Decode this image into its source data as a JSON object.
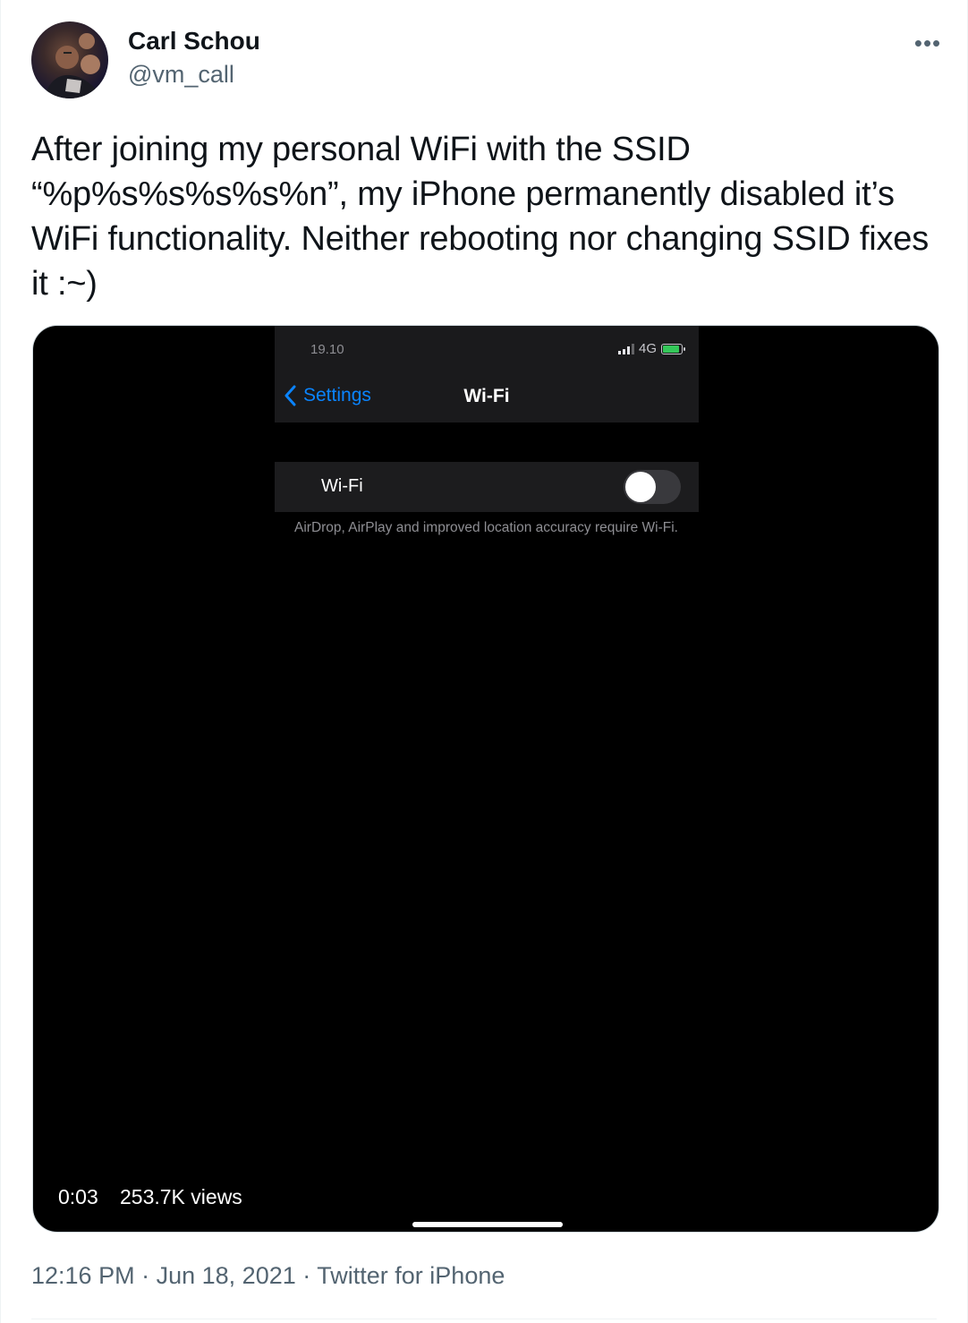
{
  "tweet": {
    "author_name": "Carl Schou",
    "author_handle": "@vm_call",
    "more_label": "•••",
    "text": "After joining my personal WiFi with the SSID “%p%s%s%s%s%n”, my iPhone permanently disabled it’s WiFi functionality. Neither rebooting nor changing SSID fixes it :~)",
    "time": "12:16 PM",
    "date": "Jun 18, 2021",
    "source": "Twitter for iPhone",
    "separator": "·"
  },
  "video": {
    "elapsed": "0:03",
    "views": "253.7K views",
    "progress_fraction": 1.0
  },
  "phone": {
    "status_time": "19.10",
    "network": "4G",
    "back_label": "Settings",
    "nav_title": "Wi-Fi",
    "wifi_row_label": "Wi-Fi",
    "wifi_enabled": false,
    "footnote": "AirDrop, AirPlay and improved location accuracy require Wi-Fi."
  },
  "colors": {
    "accent_ios": "#0a84ff",
    "text_secondary": "#536471",
    "battery_green": "#34c759"
  }
}
